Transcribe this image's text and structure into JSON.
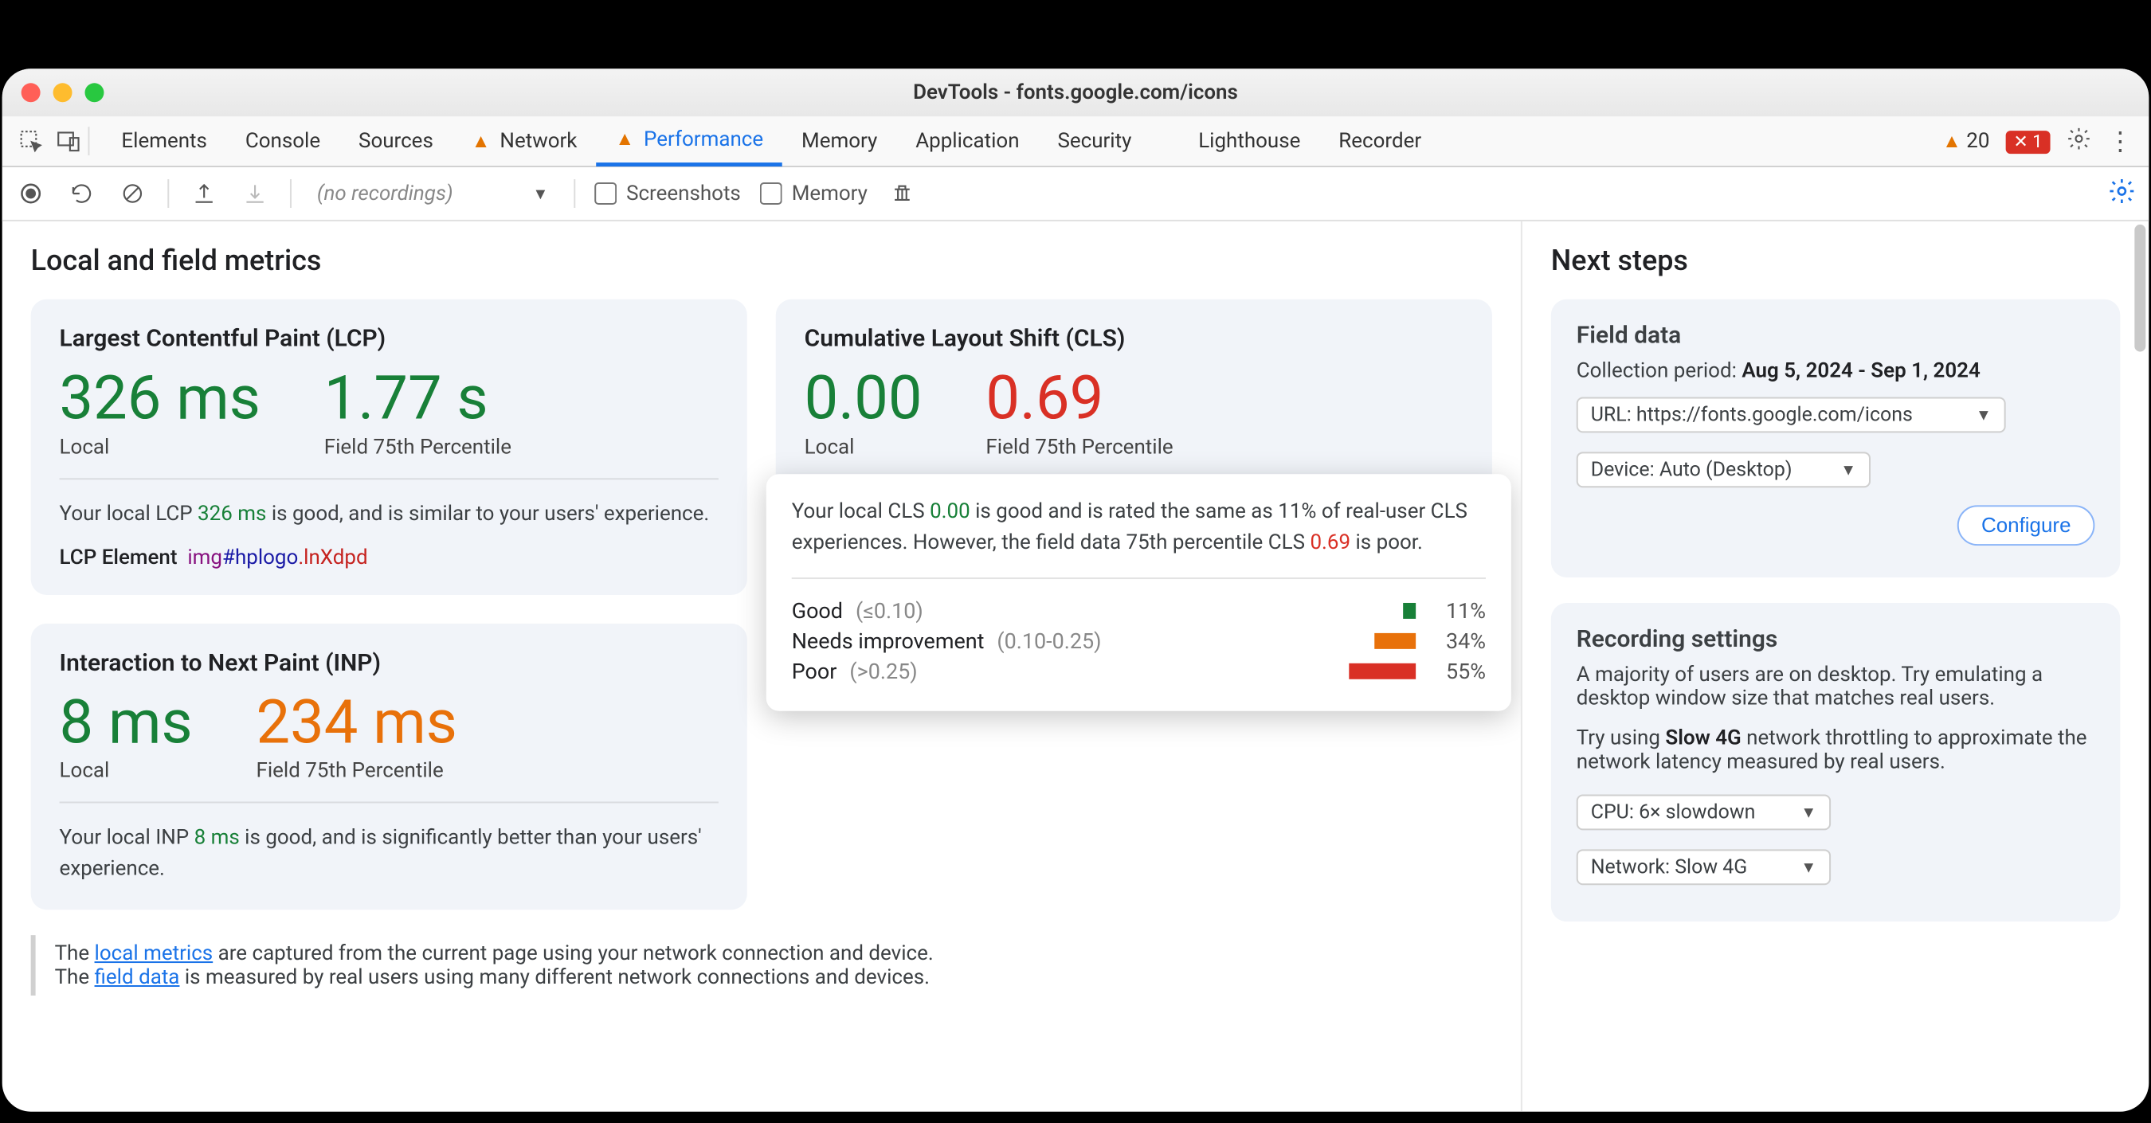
{
  "window": {
    "title": "DevTools - fonts.google.com/icons"
  },
  "tabs": {
    "items": [
      "Elements",
      "Console",
      "Sources",
      "Network",
      "Performance",
      "Memory",
      "Application",
      "Security",
      "Lighthouse",
      "Recorder"
    ],
    "warn_indices": [
      3,
      4
    ],
    "active_index": 4
  },
  "status": {
    "warn_count": "20",
    "err_count": "1"
  },
  "toolbar": {
    "recordings_placeholder": "(no recordings)",
    "screenshots_label": "Screenshots",
    "memory_label": "Memory"
  },
  "main": {
    "heading": "Local and field metrics",
    "lcp": {
      "title": "Largest Contentful Paint (LCP)",
      "local_value": "326 ms",
      "local_label": "Local",
      "field_value": "1.77 s",
      "field_label": "Field 75th Percentile",
      "desc_pre": "Your local LCP ",
      "desc_val": "326 ms",
      "desc_post": " is good, and is similar to your users' experience.",
      "lcp_el_label": "LCP Element",
      "lcp_el_tag": "img",
      "lcp_el_id": "#hplogo",
      "lcp_el_cls": ".lnXdpd"
    },
    "inp": {
      "title": "Interaction to Next Paint (INP)",
      "local_value": "8 ms",
      "local_label": "Local",
      "field_value": "234 ms",
      "field_label": "Field 75th Percentile",
      "desc_pre": "Your local INP ",
      "desc_val": "8 ms",
      "desc_post": " is good, and is significantly better than your users' experience."
    },
    "cls": {
      "title": "Cumulative Layout Shift (CLS)",
      "local_value": "0.00",
      "local_label": "Local",
      "field_value": "0.69",
      "field_label": "Field 75th Percentile",
      "tip_pre": "Your local CLS ",
      "tip_v1": "0.00",
      "tip_mid": " is good and is rated the same as 11% of real-user CLS experiences. However, the field data 75th percentile CLS ",
      "tip_v2": "0.69",
      "tip_post": " is poor.",
      "rows": [
        {
          "label": "Good",
          "range": "(≤0.10)",
          "pct": "11%",
          "w": 8,
          "cls": "good"
        },
        {
          "label": "Needs improvement",
          "range": "(0.10-0.25)",
          "pct": "34%",
          "w": 26,
          "cls": "ni"
        },
        {
          "label": "Poor",
          "range": "(>0.25)",
          "pct": "55%",
          "w": 42,
          "cls": "poor"
        }
      ]
    },
    "footnote": {
      "l1a": "The ",
      "l1link": "local metrics",
      "l1b": " are captured from the current page using your network connection and device.",
      "l2a": "The ",
      "l2link": "field data",
      "l2b": " is measured by real users using many different network connections and devices."
    }
  },
  "side": {
    "heading": "Next steps",
    "field": {
      "title": "Field data",
      "period_label": "Collection period: ",
      "period_value": "Aug 5, 2024 - Sep 1, 2024",
      "url_sel": "URL: https://fonts.google.com/icons",
      "device_sel": "Device: Auto (Desktop)",
      "configure": "Configure"
    },
    "rec": {
      "title": "Recording settings",
      "p1": "A majority of users are on desktop. Try emulating a desktop window size that matches real users.",
      "p2a": "Try using ",
      "p2b": "Slow 4G",
      "p2c": " network throttling to approximate the network latency measured by real users.",
      "cpu_sel": "CPU: 6× slowdown",
      "net_sel": "Network: Slow 4G"
    }
  }
}
